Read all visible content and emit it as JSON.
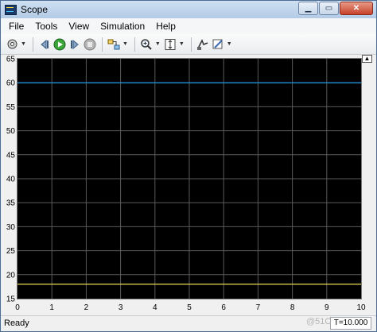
{
  "window": {
    "title": "Scope"
  },
  "menu": [
    "File",
    "Tools",
    "View",
    "Simulation",
    "Help"
  ],
  "toolbar": {
    "icons": [
      "parameters-icon",
      "step-back-icon",
      "run-icon",
      "step-forward-icon",
      "stop-icon",
      "highlight-simulink-icon",
      "zoom-in-icon",
      "fit-to-view-icon",
      "signal-selection-icon",
      "style-icon"
    ]
  },
  "plot": {
    "background": "#000000",
    "grid_color": "#5a5a5a",
    "x_ticks": [
      "0",
      "1",
      "2",
      "3",
      "4",
      "5",
      "6",
      "7",
      "8",
      "9",
      "10"
    ],
    "y_ticks": [
      "15",
      "20",
      "25",
      "30",
      "35",
      "40",
      "45",
      "50",
      "55",
      "60",
      "65"
    ]
  },
  "chart_data": {
    "type": "line",
    "xlim": [
      0,
      10
    ],
    "ylim": [
      15,
      65
    ],
    "grid": true,
    "series": [
      {
        "color": "#1f8fd6",
        "x": [
          0,
          10
        ],
        "y": [
          60,
          60
        ]
      },
      {
        "color": "#e6d75a",
        "x": [
          0,
          10
        ],
        "y": [
          18,
          18
        ]
      }
    ]
  },
  "status": {
    "text": "Ready",
    "time": "T=10.000",
    "watermark": "@51C"
  }
}
